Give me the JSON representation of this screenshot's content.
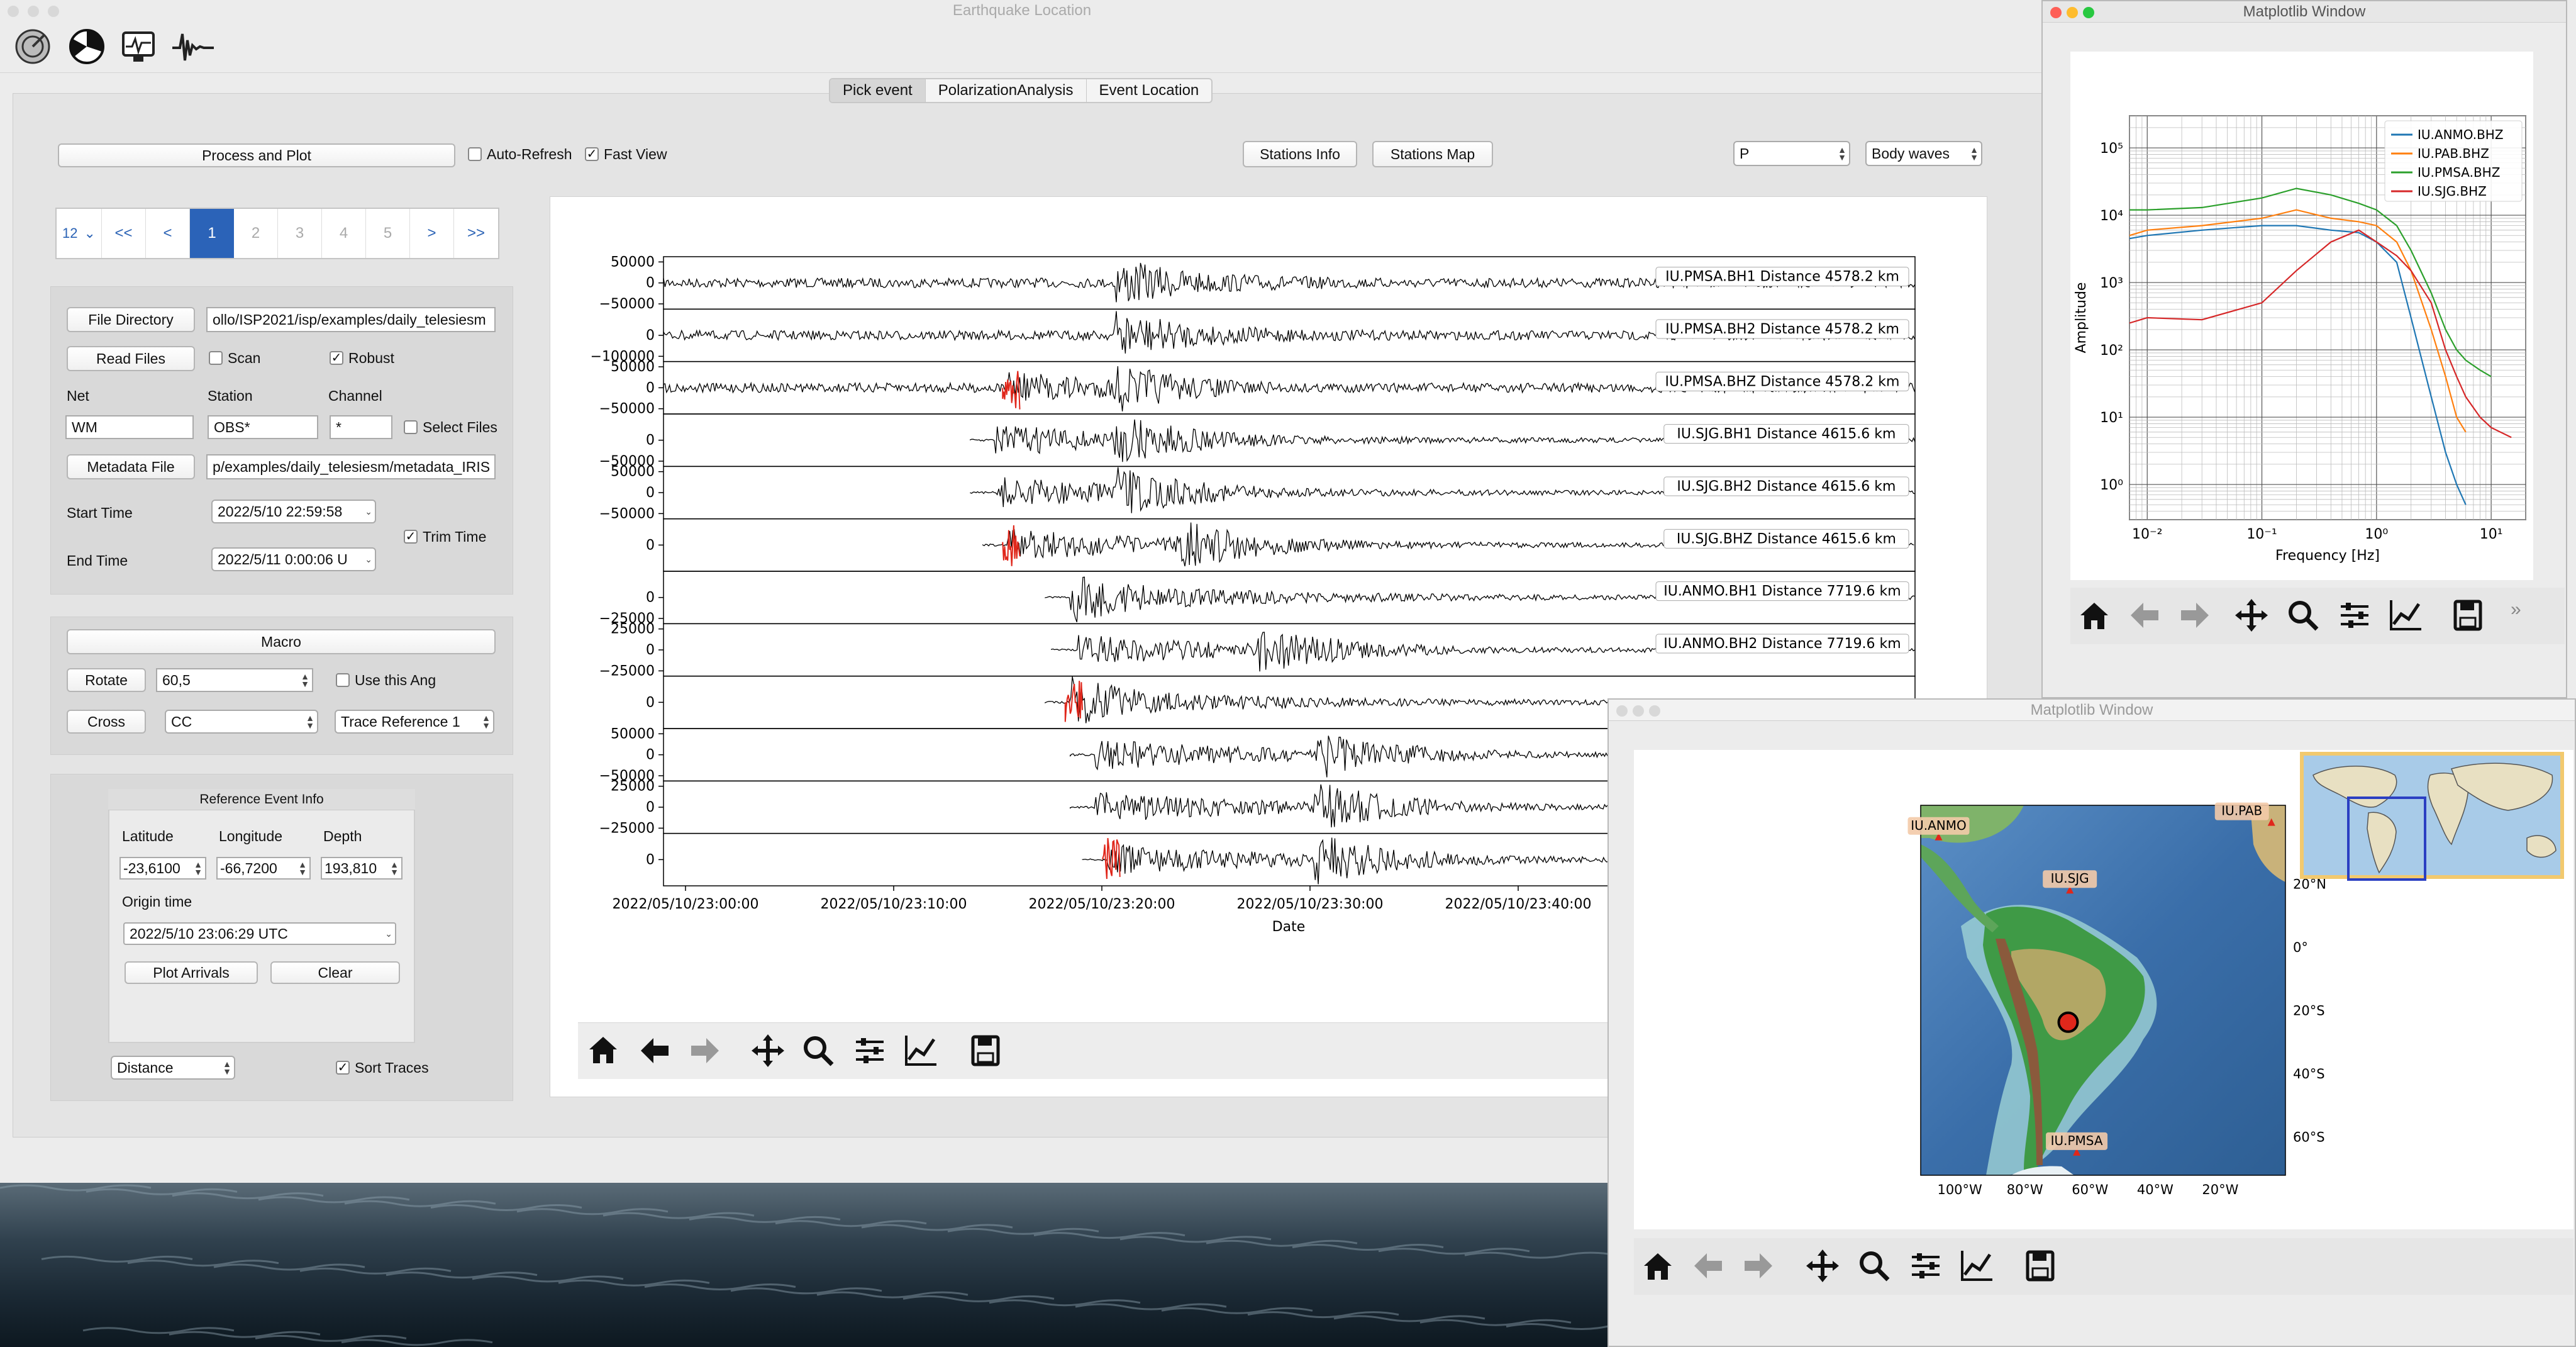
{
  "main": {
    "title": "Earthquake Location",
    "tabs": [
      {
        "label": "Pick event"
      },
      {
        "label": "PolarizationAnalysis"
      },
      {
        "label": "Event Location"
      }
    ],
    "toolbar_icons": [
      "seismometer-icon",
      "polarization-icon",
      "monitor-icon",
      "waveform-icon"
    ],
    "process_button": "Process and Plot",
    "auto_refresh": {
      "label": "Auto-Refresh",
      "checked": false
    },
    "fast_view": {
      "label": "Fast View",
      "checked": true
    },
    "stations_info_button": "Stations Info",
    "stations_map_button": "Stations Map",
    "phase_select": "P",
    "wave_select": "Body waves",
    "pager": {
      "count": "12",
      "first": "<<",
      "prev": "<",
      "pages": [
        "1",
        "2",
        "3",
        "4",
        "5"
      ],
      "next": ">",
      "last": ">>"
    },
    "file_directory_button": "File Directory",
    "file_directory_value": "ollo/ISP2021/isp/examples/daily_telesiesm",
    "read_files_button": "Read Files",
    "scan": {
      "label": "Scan",
      "checked": false
    },
    "robust": {
      "label": "Robust",
      "checked": true
    },
    "net_label": "Net",
    "station_label": "Station",
    "channel_label": "Channel",
    "net_value": "WM",
    "station_value": "OBS*",
    "channel_value": "*",
    "select_files": {
      "label": "Select Files",
      "checked": false
    },
    "metadata_file_button": "Metadata File",
    "metadata_value": "p/examples/daily_telesiesm/metadata_IRIS",
    "start_time_label": "Start Time",
    "start_time_value": "2022/5/10 22:59:58",
    "end_time_label": "End Time",
    "end_time_value": "2022/5/11 0:00:06 U",
    "trim_time": {
      "label": "Trim Time",
      "checked": true
    },
    "macro_button": "Macro",
    "rotate_button": "Rotate",
    "rotate_value": "60,5",
    "use_angle": {
      "label": "Use this Ang",
      "checked": false
    },
    "cross_button": "Cross",
    "cross_select": "CC",
    "trace_ref_select": "Trace Reference 1",
    "ref_event_title": "Reference Event Info",
    "latitude_label": "Latitude",
    "longitude_label": "Longitude",
    "depth_label": "Depth",
    "latitude_value": "-23,6100",
    "longitude_value": "-66,7200",
    "depth_value": "193,810",
    "origin_time_label": "Origin time",
    "origin_time_value": "2022/5/10 23:06:29 UTC",
    "plot_arrivals_button": "Plot Arrivals",
    "clear_button": "Clear",
    "sort_select": "Distance",
    "sort_traces": {
      "label": "Sort  Traces",
      "checked": true
    }
  },
  "seismo_plot": {
    "xlabel": "Date",
    "xticks": [
      "2022/05/10/23:00:00",
      "2022/05/10/23:10:00",
      "2022/05/10/23:20:00",
      "2022/05/10/23:30:00",
      "2022/05/10/23:40:00"
    ],
    "traces": [
      {
        "label": "IU.PMSA.BH1 Distance 4578.2 km",
        "yticks": [
          "50000",
          "0",
          "−50000"
        ],
        "pick": false,
        "color": "#000000"
      },
      {
        "label": "IU.PMSA.BH2 Distance 4578.2 km",
        "yticks": [
          "0",
          "−100000"
        ],
        "pick": false,
        "color": "#000000"
      },
      {
        "label": "IU.PMSA.BHZ Distance 4578.2 km",
        "yticks": [
          "50000",
          "0",
          "−50000"
        ],
        "pick": true,
        "color": "#000000"
      },
      {
        "label": "IU.SJG.BH1 Distance 4615.6 km",
        "yticks": [
          "0",
          "−50000"
        ],
        "pick": false,
        "color": "#000000"
      },
      {
        "label": "IU.SJG.BH2 Distance 4615.6 km",
        "yticks": [
          "50000",
          "0",
          "−50000"
        ],
        "pick": false,
        "color": "#000000"
      },
      {
        "label": "IU.SJG.BHZ Distance 4615.6 km",
        "yticks": [
          "0"
        ],
        "pick": true,
        "color": "#000000"
      },
      {
        "label": "IU.ANMO.BH1 Distance 7719.6 km",
        "yticks": [
          "0",
          "−25000"
        ],
        "pick": false,
        "color": "#000000"
      },
      {
        "label": "IU.ANMO.BH2 Distance 7719.6 km",
        "yticks": [
          "25000",
          "0",
          "−25000"
        ],
        "pick": false,
        "color": "#000000"
      },
      {
        "label": "",
        "yticks": [
          "0"
        ],
        "pick": true,
        "color": "#000000"
      },
      {
        "label": "",
        "yticks": [
          "50000",
          "0",
          "−50000"
        ],
        "pick": false,
        "color": "#000000"
      },
      {
        "label": "",
        "yticks": [
          "25000",
          "0",
          "−25000"
        ],
        "pick": false,
        "color": "#000000"
      },
      {
        "label": "",
        "yticks": [
          "0"
        ],
        "pick": true,
        "color": "#000000"
      }
    ]
  },
  "spectrum_window": {
    "title": "Matplotlib Window",
    "chart_data": {
      "type": "line",
      "xscale": "log",
      "yscale": "log",
      "xlabel": "Frequency [Hz]",
      "ylabel": "Amplitude",
      "xticks": [
        "10⁻²",
        "10⁻¹",
        "10⁰",
        "10¹"
      ],
      "yticks": [
        "10⁵",
        "10⁴",
        "10³",
        "10²",
        "10¹",
        "10⁰"
      ],
      "xlim": [
        0.007,
        20
      ],
      "ylim": [
        0.3,
        300000
      ],
      "grid": true,
      "legend_placement": "top-right",
      "series": [
        {
          "name": "IU.ANMO.BHZ",
          "color": "#1f77b4",
          "x": [
            0.007,
            0.01,
            0.03,
            0.1,
            0.2,
            0.4,
            0.7,
            1,
            1.5,
            2,
            3,
            4,
            5,
            6
          ],
          "y": [
            4500,
            5000,
            6000,
            7000,
            7000,
            6000,
            5500,
            4000,
            2000,
            300,
            20,
            3,
            1,
            0.5
          ]
        },
        {
          "name": "IU.PAB.BHZ",
          "color": "#ff7f0e",
          "x": [
            0.007,
            0.01,
            0.03,
            0.1,
            0.2,
            0.4,
            0.7,
            1,
            1.5,
            2,
            3,
            4,
            5,
            6
          ],
          "y": [
            5000,
            6000,
            7000,
            9000,
            12000,
            9000,
            8000,
            7000,
            4000,
            1500,
            200,
            40,
            10,
            6
          ]
        },
        {
          "name": "IU.PMSA.BHZ",
          "color": "#2ca02c",
          "x": [
            0.007,
            0.01,
            0.03,
            0.1,
            0.2,
            0.4,
            0.7,
            1,
            1.5,
            2,
            3,
            4,
            5,
            6,
            8,
            10
          ],
          "y": [
            12000,
            12000,
            13000,
            18000,
            25000,
            20000,
            15000,
            12000,
            7000,
            3000,
            700,
            200,
            100,
            70,
            50,
            40
          ]
        },
        {
          "name": "IU.SJG.BHZ",
          "color": "#d62728",
          "x": [
            0.007,
            0.01,
            0.03,
            0.1,
            0.2,
            0.4,
            0.7,
            1,
            1.5,
            2,
            3,
            4,
            5,
            6,
            8,
            10,
            15
          ],
          "y": [
            250,
            300,
            280,
            500,
            1500,
            4000,
            6000,
            4000,
            2500,
            1500,
            500,
            100,
            40,
            20,
            10,
            7,
            5
          ]
        }
      ]
    }
  },
  "map_window": {
    "title": "Matplotlib Window",
    "stations": [
      {
        "name": "IU.ANMO",
        "lon": -106.5,
        "lat": 34.9
      },
      {
        "name": "IU.PAB",
        "lon": -4.3,
        "lat": 39.5
      },
      {
        "name": "IU.SJG",
        "lon": -66.2,
        "lat": 18.1
      },
      {
        "name": "IU.PMSA",
        "lon": -64.1,
        "lat": -64.8
      }
    ],
    "event": {
      "lon": -66.72,
      "lat": -23.61
    },
    "lon_ticks": [
      "100°W",
      "80°W",
      "60°W",
      "40°W",
      "20°W"
    ],
    "lat_ticks": [
      "20°N",
      "0°",
      "20°S",
      "40°S",
      "60°S"
    ]
  }
}
